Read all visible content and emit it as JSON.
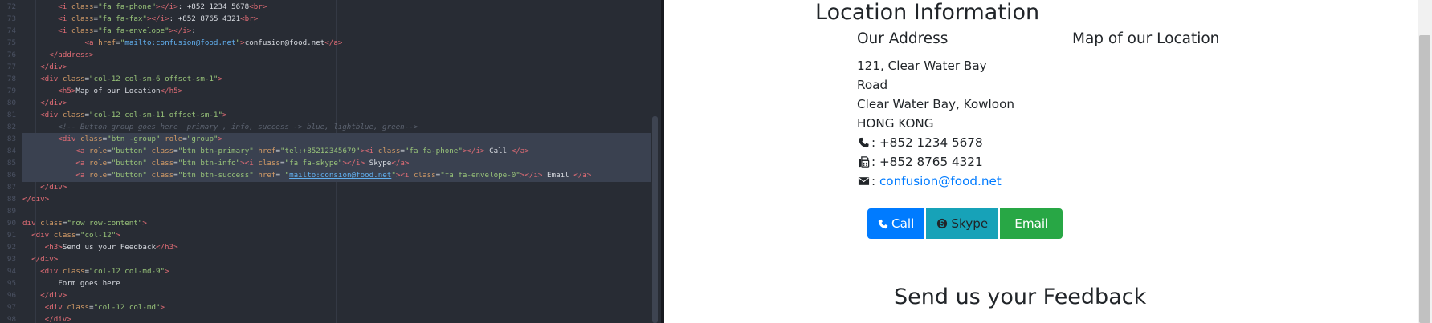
{
  "editor": {
    "lines": [
      {
        "n": "72",
        "parts": [
          [
            "txt",
            "        "
          ],
          [
            "tag",
            "<i "
          ],
          [
            "attr",
            "class"
          ],
          [
            "txt",
            "="
          ],
          [
            "str",
            "\"fa fa-phone\""
          ],
          [
            "tag",
            "></i>"
          ],
          [
            "txt",
            ": +852 1234 5678"
          ],
          [
            "tag",
            "<br>"
          ]
        ]
      },
      {
        "n": "73",
        "parts": [
          [
            "txt",
            "        "
          ],
          [
            "tag",
            "<i "
          ],
          [
            "attr",
            "class"
          ],
          [
            "txt",
            "="
          ],
          [
            "str",
            "\"fa fa-fax\""
          ],
          [
            "tag",
            "></i>"
          ],
          [
            "txt",
            ": +852 8765 4321"
          ],
          [
            "tag",
            "<br>"
          ]
        ]
      },
      {
        "n": "74",
        "parts": [
          [
            "txt",
            "        "
          ],
          [
            "tag",
            "<i "
          ],
          [
            "attr",
            "class"
          ],
          [
            "txt",
            "="
          ],
          [
            "str",
            "\"fa fa-envelope\""
          ],
          [
            "tag",
            "></i>"
          ],
          [
            "txt",
            ":"
          ]
        ]
      },
      {
        "n": "75",
        "parts": [
          [
            "txt",
            "              "
          ],
          [
            "tag",
            "<a "
          ],
          [
            "attr",
            "href"
          ],
          [
            "txt",
            "="
          ],
          [
            "str",
            "\""
          ],
          [
            "link",
            "mailto:confusion@food.net"
          ],
          [
            "str",
            "\""
          ],
          [
            "tag",
            ">"
          ],
          [
            "txt",
            "confusion@food.net"
          ],
          [
            "tag",
            "</a>"
          ]
        ]
      },
      {
        "n": "76",
        "parts": [
          [
            "txt",
            "      "
          ],
          [
            "tag",
            "</address>"
          ]
        ]
      },
      {
        "n": "77",
        "parts": [
          [
            "txt",
            "    "
          ],
          [
            "tag",
            "</div>"
          ]
        ]
      },
      {
        "n": "78",
        "parts": [
          [
            "txt",
            "    "
          ],
          [
            "tag",
            "<div "
          ],
          [
            "attr",
            "class"
          ],
          [
            "txt",
            "="
          ],
          [
            "str",
            "\"col-12 col-sm-6 offset-sm-1\""
          ],
          [
            "tag",
            ">"
          ]
        ]
      },
      {
        "n": "79",
        "parts": [
          [
            "txt",
            "        "
          ],
          [
            "tag",
            "<h5>"
          ],
          [
            "txt",
            "Map of our Location"
          ],
          [
            "tag",
            "</h5>"
          ]
        ]
      },
      {
        "n": "80",
        "parts": [
          [
            "txt",
            "    "
          ],
          [
            "tag",
            "</div>"
          ]
        ]
      },
      {
        "n": "81",
        "parts": [
          [
            "txt",
            "    "
          ],
          [
            "tag",
            "<div "
          ],
          [
            "attr",
            "class"
          ],
          [
            "txt",
            "="
          ],
          [
            "str",
            "\"col-12 col-sm-11 offset-sm-1\""
          ],
          [
            "tag",
            ">"
          ]
        ]
      },
      {
        "n": "82",
        "parts": [
          [
            "cmt",
            "        <!-- Button group goes here  primary , info, success -> blue, lightblue, green-->"
          ]
        ]
      },
      {
        "n": "83",
        "parts": [
          [
            "txt",
            "        "
          ],
          [
            "tag",
            "<div "
          ],
          [
            "attr",
            "class"
          ],
          [
            "txt",
            "="
          ],
          [
            "str",
            "\"btn -group\""
          ],
          [
            "txt",
            " "
          ],
          [
            "attr",
            "role"
          ],
          [
            "txt",
            "="
          ],
          [
            "str",
            "\"group\""
          ],
          [
            "tag",
            ">"
          ]
        ]
      },
      {
        "n": "84",
        "parts": [
          [
            "txt",
            "            "
          ],
          [
            "tag",
            "<a "
          ],
          [
            "attr",
            "role"
          ],
          [
            "txt",
            "="
          ],
          [
            "str",
            "\"button\""
          ],
          [
            "txt",
            " "
          ],
          [
            "attr",
            "class"
          ],
          [
            "txt",
            "="
          ],
          [
            "str",
            "\"btn btn-primary\""
          ],
          [
            "txt",
            " "
          ],
          [
            "attr",
            "href"
          ],
          [
            "txt",
            "="
          ],
          [
            "str",
            "\"tel:+85212345679\""
          ],
          [
            "tag",
            "><i "
          ],
          [
            "attr",
            "class"
          ],
          [
            "txt",
            "="
          ],
          [
            "str",
            "\"fa fa-phone\""
          ],
          [
            "tag",
            "></i>"
          ],
          [
            "txt",
            " Call "
          ],
          [
            "tag",
            "</a>"
          ]
        ]
      },
      {
        "n": "85",
        "parts": [
          [
            "txt",
            "            "
          ],
          [
            "tag",
            "<a "
          ],
          [
            "attr",
            "role"
          ],
          [
            "txt",
            "="
          ],
          [
            "str",
            "\"button\""
          ],
          [
            "txt",
            " "
          ],
          [
            "attr",
            "class"
          ],
          [
            "txt",
            "="
          ],
          [
            "str",
            "\"btn btn-info\""
          ],
          [
            "tag",
            "><i "
          ],
          [
            "attr",
            "class"
          ],
          [
            "txt",
            "="
          ],
          [
            "str",
            "\"fa fa-skype\""
          ],
          [
            "tag",
            "></i>"
          ],
          [
            "txt",
            " Skype"
          ],
          [
            "tag",
            "</a>"
          ]
        ]
      },
      {
        "n": "86",
        "parts": [
          [
            "txt",
            "            "
          ],
          [
            "tag",
            "<a "
          ],
          [
            "attr",
            "role"
          ],
          [
            "txt",
            "="
          ],
          [
            "str",
            "\"button\""
          ],
          [
            "txt",
            " "
          ],
          [
            "attr",
            "class"
          ],
          [
            "txt",
            "="
          ],
          [
            "str",
            "\"btn btn-success\""
          ],
          [
            "txt",
            " "
          ],
          [
            "attr",
            "href"
          ],
          [
            "txt",
            "= "
          ],
          [
            "str",
            "\""
          ],
          [
            "link",
            "mailto:consion@food.net"
          ],
          [
            "str",
            "\""
          ],
          [
            "tag",
            "><i "
          ],
          [
            "attr",
            "class"
          ],
          [
            "txt",
            "="
          ],
          [
            "str",
            "\"fa fa-envelope-0\""
          ],
          [
            "tag",
            "></i>"
          ],
          [
            "txt",
            " Email "
          ],
          [
            "tag",
            "</a>"
          ]
        ]
      },
      {
        "n": "87",
        "parts": [
          [
            "txt",
            "    "
          ],
          [
            "tag",
            "</div>"
          ]
        ]
      },
      {
        "n": "88",
        "parts": [
          [
            "tag",
            "</div>"
          ]
        ]
      },
      {
        "n": "89",
        "parts": []
      },
      {
        "n": "90",
        "parts": [
          [
            "tag",
            "div "
          ],
          [
            "attr",
            "class"
          ],
          [
            "txt",
            "="
          ],
          [
            "str",
            "\"row row-content\""
          ],
          [
            "tag",
            ">"
          ]
        ]
      },
      {
        "n": "91",
        "parts": [
          [
            "txt",
            "  "
          ],
          [
            "tag",
            "<div "
          ],
          [
            "attr",
            "class"
          ],
          [
            "txt",
            "="
          ],
          [
            "str",
            "\"col-12\""
          ],
          [
            "tag",
            ">"
          ]
        ]
      },
      {
        "n": "92",
        "parts": [
          [
            "txt",
            "     "
          ],
          [
            "tag",
            "<h3>"
          ],
          [
            "txt",
            "Send us your Feedback"
          ],
          [
            "tag",
            "</h3>"
          ]
        ]
      },
      {
        "n": "93",
        "parts": [
          [
            "txt",
            "  "
          ],
          [
            "tag",
            "</div>"
          ]
        ]
      },
      {
        "n": "94",
        "parts": [
          [
            "txt",
            "    "
          ],
          [
            "tag",
            "<div "
          ],
          [
            "attr",
            "class"
          ],
          [
            "txt",
            "="
          ],
          [
            "str",
            "\"col-12 col-md-9\""
          ],
          [
            "tag",
            ">"
          ]
        ]
      },
      {
        "n": "95",
        "parts": [
          [
            "txt",
            "        Form goes here"
          ]
        ]
      },
      {
        "n": "96",
        "parts": [
          [
            "txt",
            "    "
          ],
          [
            "tag",
            "</div>"
          ]
        ]
      },
      {
        "n": "97",
        "parts": [
          [
            "txt",
            "     "
          ],
          [
            "tag",
            "<div "
          ],
          [
            "attr",
            "class"
          ],
          [
            "txt",
            "="
          ],
          [
            "str",
            "\"col-12 col-md\""
          ],
          [
            "tag",
            ">"
          ]
        ]
      },
      {
        "n": "98",
        "parts": [
          [
            "txt",
            "     "
          ],
          [
            "tag",
            "</div>"
          ]
        ]
      }
    ]
  },
  "preview": {
    "section_title": "Location Information",
    "address_heading": "Our Address",
    "map_heading": "Map of our Location",
    "address_lines": [
      "121, Clear Water Bay",
      "Road",
      "Clear Water Bay, Kowloon",
      "HONG KONG"
    ],
    "phone": ": +852 1234 5678",
    "fax": ": +852 8765 4321",
    "email_prefix": ":",
    "email": "confusion@food.net",
    "buttons": {
      "call": "Call",
      "skype": "Skype",
      "email": "Email"
    },
    "feedback_title": "Send us your Feedback"
  }
}
